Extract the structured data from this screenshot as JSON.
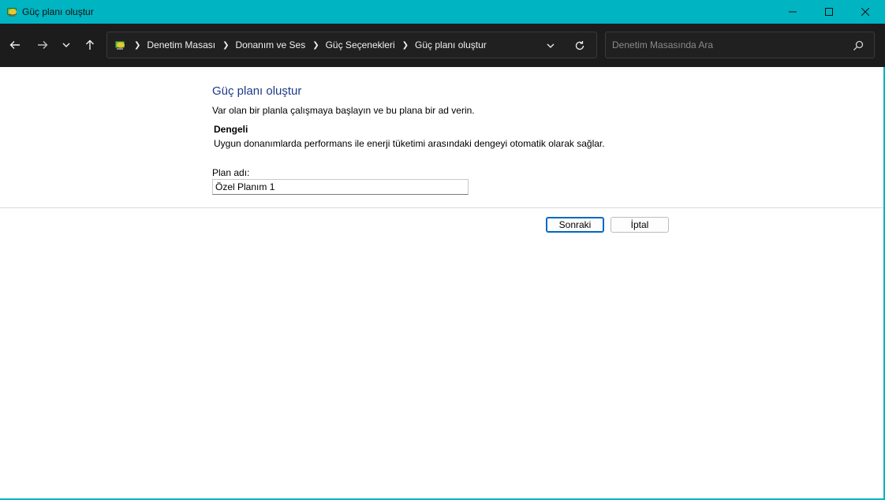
{
  "window": {
    "title": "Güç planı oluştur",
    "accent_color": "#00b4c2"
  },
  "titlebar": {
    "icon": "power-options-icon",
    "buttons": [
      "minimize-icon",
      "maximize-icon",
      "close-icon"
    ]
  },
  "navbar": {
    "breadcrumbs": [
      "Denetim Masası",
      "Donanım ve Ses",
      "Güç Seçenekleri",
      "Güç planı oluştur"
    ],
    "search_placeholder": "Denetim Masasında Ara"
  },
  "main": {
    "page_title": "Güç planı oluştur",
    "intro": "Var olan bir planla çalışmaya başlayın ve bu plana bir ad verin.",
    "selected_plan": {
      "name": "Dengeli",
      "description": "Uygun donanımlarda performans ile enerji tüketimi arasındaki dengeyi otomatik olarak sağlar."
    },
    "plan_name_label": "Plan adı:",
    "plan_name_value": "Özel Planım 1",
    "next_button": "Sonraki",
    "cancel_button": "İptal"
  }
}
